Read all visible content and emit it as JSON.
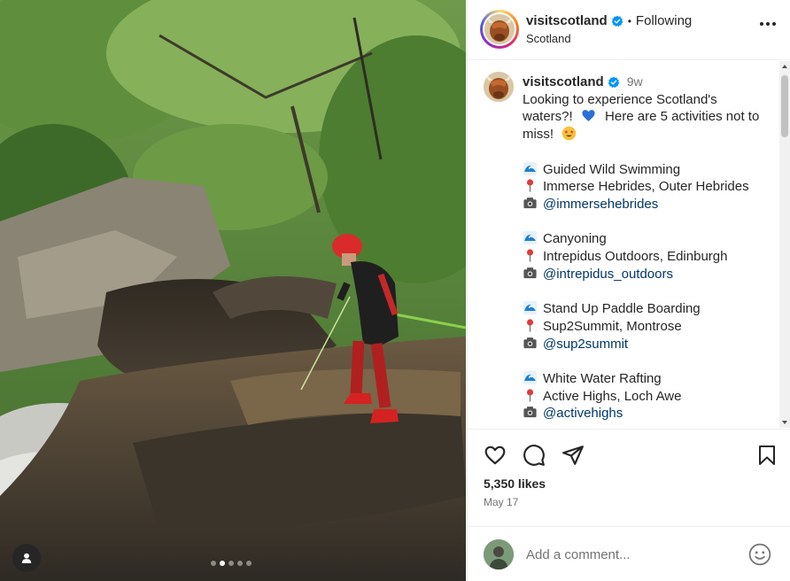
{
  "post": {
    "username": "visitscotland",
    "follow_status": "Following",
    "bullet": "•",
    "location": "Scotland",
    "caption_time": "9w",
    "caption_intro": [
      "Looking to experience Scotland's",
      "waters?!",
      "Here are 5 activities not to",
      "miss!"
    ],
    "activities": [
      {
        "name": "Guided Wild Swimming",
        "place": "Immerse Hebrides, Outer Hebrides",
        "handle": "@immersehebrides"
      },
      {
        "name": "Canyoning",
        "place": "Intrepidus Outdoors, Edinburgh",
        "handle": "@intrepidus_outdoors"
      },
      {
        "name": "Stand Up Paddle Boarding",
        "place": "Sup2Summit, Montrose",
        "handle": "@sup2summit"
      },
      {
        "name": "White Water Rafting",
        "place": "Active Highs, Loch Awe",
        "handle": "@activehighs"
      }
    ],
    "likes": "5,350 likes",
    "date": "May 17",
    "comment_placeholder": "Add a comment...",
    "carousel": {
      "count": 5,
      "active_index": 1
    }
  },
  "icons": {
    "verified": "verified-badge-icon",
    "more": "more-options-icon",
    "like": "heart-icon",
    "comment": "comment-icon",
    "share": "share-icon",
    "save": "bookmark-icon",
    "emoji": "emoji-icon",
    "tag": "user-tag-icon",
    "wave": "wave-icon",
    "pin": "pin-icon",
    "camera": "camera-icon",
    "heart_blue": "blue-heart-icon",
    "star_eyes": "star-struck-icon"
  },
  "colors": {
    "verified": "#0095f6",
    "mention": "#00376b",
    "secondary_text": "#737373"
  }
}
